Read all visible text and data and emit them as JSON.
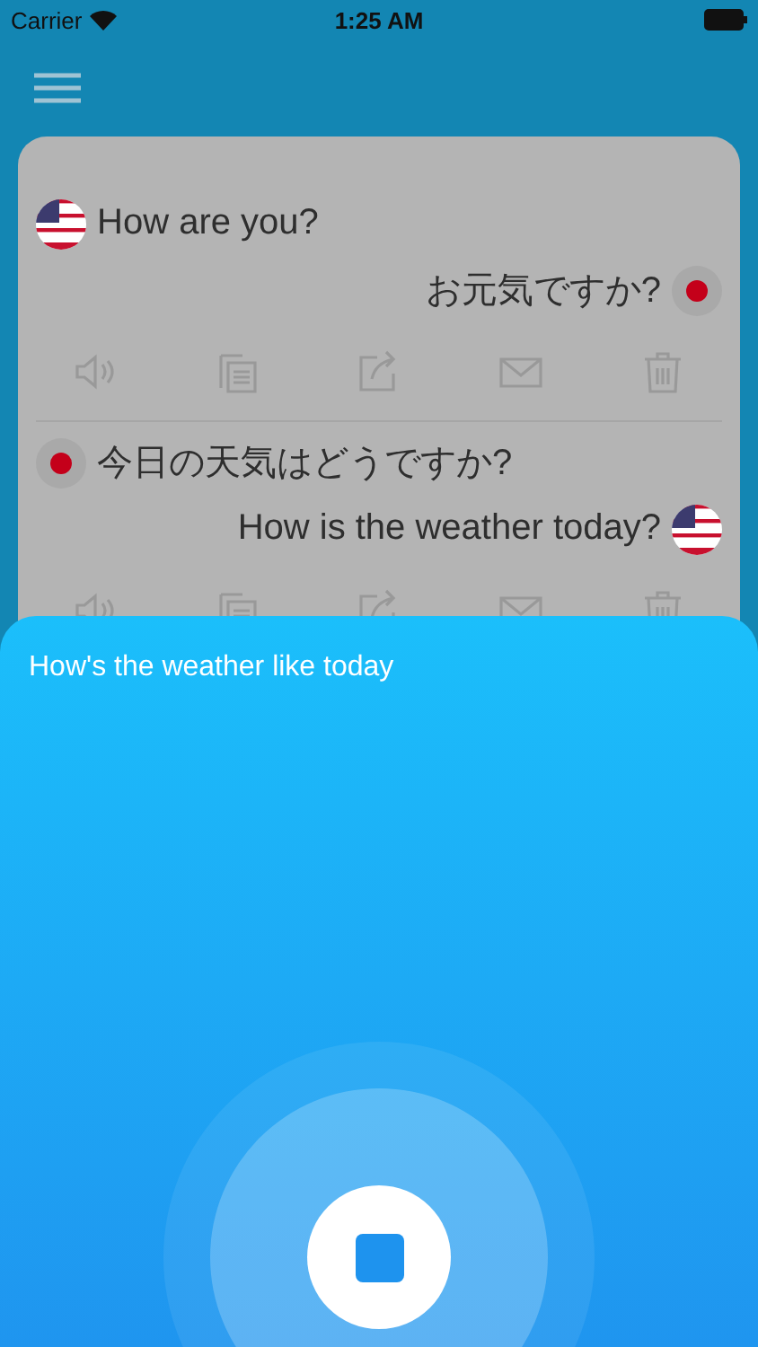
{
  "status_bar": {
    "carrier": "Carrier",
    "time": "1:25 AM"
  },
  "conversation": [
    {
      "source": {
        "text": "How are you?",
        "kind": "us"
      },
      "translation": {
        "text": "お元気ですか?",
        "kind": "jp"
      }
    },
    {
      "source": {
        "text": "今日の天気はどうですか?",
        "kind": "jp"
      },
      "translation": {
        "text": "How is the weather today?",
        "kind": "us"
      }
    }
  ],
  "listening": {
    "transcript": "How's the weather like today",
    "recording": true
  }
}
